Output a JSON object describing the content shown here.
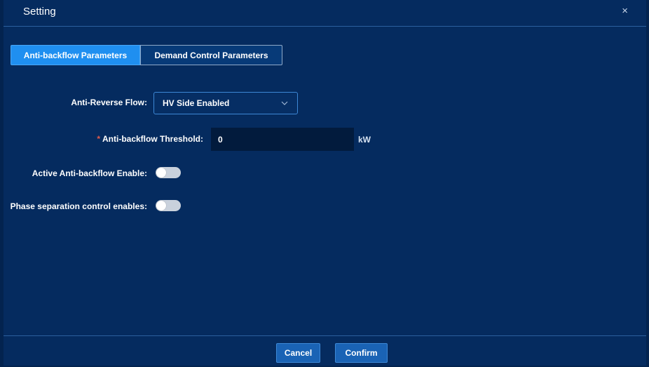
{
  "dialog": {
    "title": "Setting",
    "close_icon": "close-icon",
    "close_glyph": "×"
  },
  "tabs": [
    {
      "label": "Anti-backflow Parameters",
      "active": true
    },
    {
      "label": "Demand Control Parameters",
      "active": false
    }
  ],
  "form": {
    "anti_reverse_flow": {
      "label": "Anti-Reverse Flow:",
      "value": "HV Side Enabled"
    },
    "threshold": {
      "required_mark": "*",
      "label": "Anti-backflow Threshold:",
      "value": "0",
      "unit": "kW"
    },
    "active_anti_backflow": {
      "label": "Active Anti-backflow Enable:",
      "enabled": false
    },
    "phase_separation": {
      "label": "Phase separation control enables:",
      "enabled": false
    }
  },
  "footer": {
    "cancel_label": "Cancel",
    "confirm_label": "Confirm"
  },
  "colors": {
    "background": "#052b5f",
    "accent": "#1f8ff0",
    "button": "#1a63b5",
    "required": "#e05a4c"
  }
}
